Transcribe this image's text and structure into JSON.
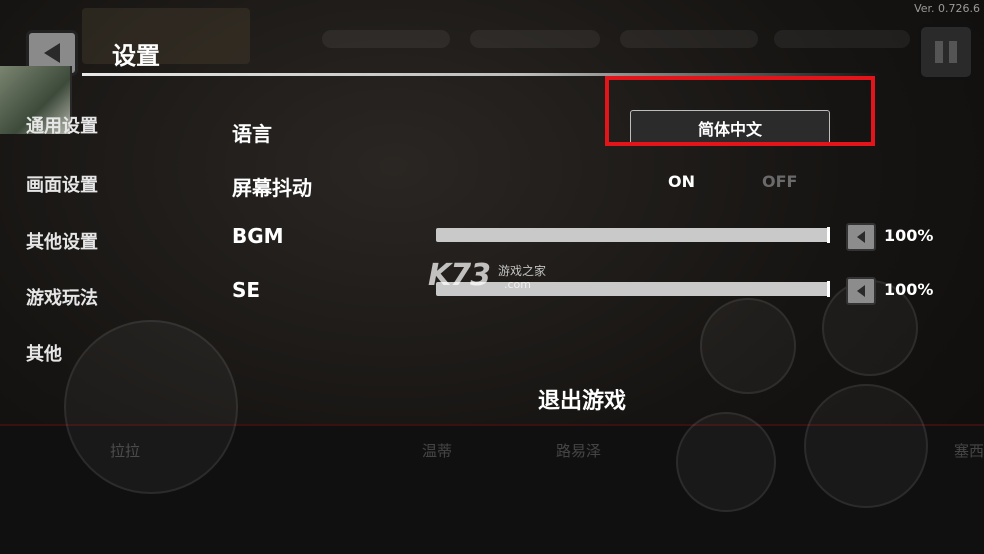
{
  "version": "Ver. 0.726.6",
  "header": {
    "title": "设置"
  },
  "sidebar": {
    "items": [
      {
        "label": "通用设置"
      },
      {
        "label": "画面设置"
      },
      {
        "label": "其他设置"
      },
      {
        "label": "游戏玩法"
      },
      {
        "label": "其他"
      }
    ]
  },
  "settings": {
    "language": {
      "label": "语言",
      "value": "简体中文"
    },
    "screen_shake": {
      "label": "屏幕抖动",
      "on_label": "ON",
      "off_label": "OFF",
      "selected": "ON"
    },
    "bgm": {
      "label": "BGM",
      "level": 1.0,
      "percent_text": "100%"
    },
    "se": {
      "label": "SE",
      "level": 1.0,
      "percent_text": "100%"
    }
  },
  "exit_label": "退出游戏",
  "background_names": [
    "拉拉",
    "温蒂",
    "路易泽",
    "塞西"
  ],
  "watermark": {
    "brand": "K73",
    "subtitle": "游戏之家",
    "domain": ".com"
  },
  "colors": {
    "highlight": "#e3141a",
    "on_color": "#ffffff",
    "off_color": "#6a6a6a"
  },
  "icons": {
    "back": "back-arrow-icon",
    "pause": "pause-icon",
    "volume": "speaker-icon"
  }
}
